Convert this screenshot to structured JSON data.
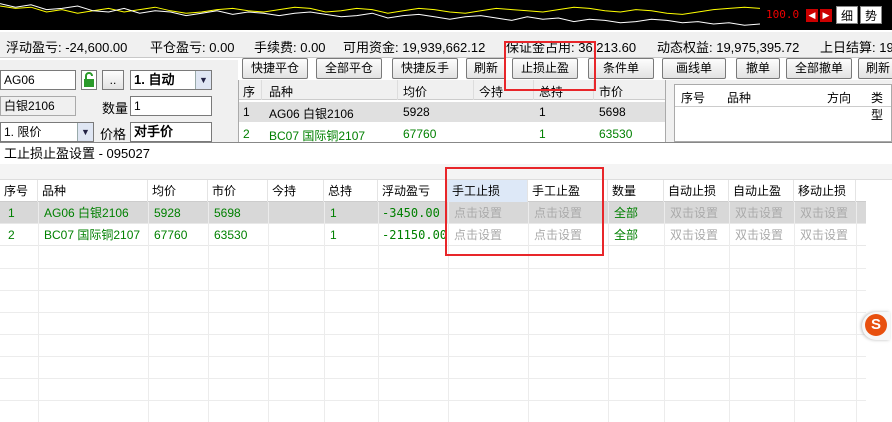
{
  "ticker": {
    "value": "100.0",
    "tabs": [
      "细",
      "势"
    ],
    "series": [
      {
        "color": "#ffff00",
        "values": [
          20,
          18,
          19,
          15,
          17,
          14,
          16,
          18,
          15,
          17,
          19,
          16,
          14,
          15,
          17,
          18,
          16,
          15,
          17,
          19,
          18,
          15,
          16,
          18,
          17,
          14,
          16,
          18,
          17,
          15,
          14,
          16,
          18,
          17,
          16,
          15,
          17,
          19,
          18,
          16,
          15,
          17,
          16,
          14,
          13,
          15,
          17,
          18,
          19,
          18
        ]
      },
      {
        "color": "#ffffff",
        "values": [
          22,
          19,
          21,
          17,
          18,
          20,
          16,
          15,
          18,
          14,
          16,
          15,
          12,
          14,
          16,
          13,
          15,
          14,
          12,
          14,
          15,
          13,
          11,
          12,
          14,
          10,
          12,
          13,
          11,
          9,
          11,
          12,
          10,
          8,
          11,
          9,
          10,
          7,
          9,
          8,
          6,
          7,
          9,
          8,
          6,
          7,
          5,
          6,
          4,
          5
        ]
      }
    ]
  },
  "summary": {
    "floating_pnl": "浮动盈亏: -24,600.00",
    "closed_pnl": "平仓盈亏: 0.00",
    "fee": "手续费: 0.00",
    "available": "可用资金: 19,939,662.12",
    "margin": "保证金占用: 36,213.60",
    "dynamic_equity": "动态权益: 19,975,395.72",
    "prev_settlement": "上日结算: 19,"
  },
  "order_panel": {
    "contract_code": "AG06",
    "auto_label": "1. 自动",
    "contract_name": "白银2106",
    "qty_label": "数量",
    "qty_value": "1",
    "order_type": "1. 限价",
    "price_label": "价格",
    "price_value": "对手价",
    "more_btn": ".."
  },
  "toolbar": {
    "quick_close": "快捷平仓",
    "close_all": "全部平仓",
    "quick_reverse": "快捷反手",
    "refresh": "刷新",
    "stop_profit": "止损止盈",
    "conditional": "条件单",
    "line_order": "画线单",
    "cancel": "撤单",
    "cancel_all": "全部撤单",
    "refresh_right": "刷新"
  },
  "mini_table": {
    "headers": [
      "序",
      "品种",
      "均价",
      "今持",
      "总持",
      "市价"
    ],
    "rows": [
      [
        "1",
        "AG06 白银2106",
        "5928",
        "",
        "1",
        "5698"
      ],
      [
        "2",
        "BC07 国际铜2107",
        "67760",
        "",
        "1",
        "63530"
      ]
    ]
  },
  "orders_panel": {
    "headers": [
      "序号",
      "品种",
      "方向",
      "类型"
    ]
  },
  "dialog": {
    "title": "工止损止盈设置 - 095027",
    "headers": [
      "序号",
      "品种",
      "均价",
      "市价",
      "今持",
      "总持",
      "浮动盈亏",
      "手工止损",
      "手工止盈",
      "数量",
      "自动止损",
      "自动止盈",
      "移动止损"
    ],
    "rows": [
      {
        "seq": "1",
        "symbol": "AG06 白银2106",
        "avg": "5928",
        "market": "5698",
        "today": "",
        "total": "1",
        "pnl": "-3450.00",
        "manual_sl": "点击设置",
        "manual_tp": "点击设置",
        "qty": "全部",
        "auto_sl": "双击设置",
        "auto_tp": "双击设置",
        "trail_sl": "双击设置"
      },
      {
        "seq": "2",
        "symbol": "BC07 国际铜2107",
        "avg": "67760",
        "market": "63530",
        "today": "",
        "total": "1",
        "pnl": "-21150.00",
        "manual_sl": "点击设置",
        "manual_tp": "点击设置",
        "qty": "全部",
        "auto_sl": "双击设置",
        "auto_tp": "双击设置",
        "trail_sl": "双击设置"
      }
    ]
  },
  "colors": {
    "highlight_border": "#e8262a",
    "row_text": "#008000",
    "hint_text": "#aaaaaa",
    "selected_row": "#d8d8d8",
    "selected_header": "#dde8f7"
  },
  "ime_icon": "sogou-ime-icon"
}
